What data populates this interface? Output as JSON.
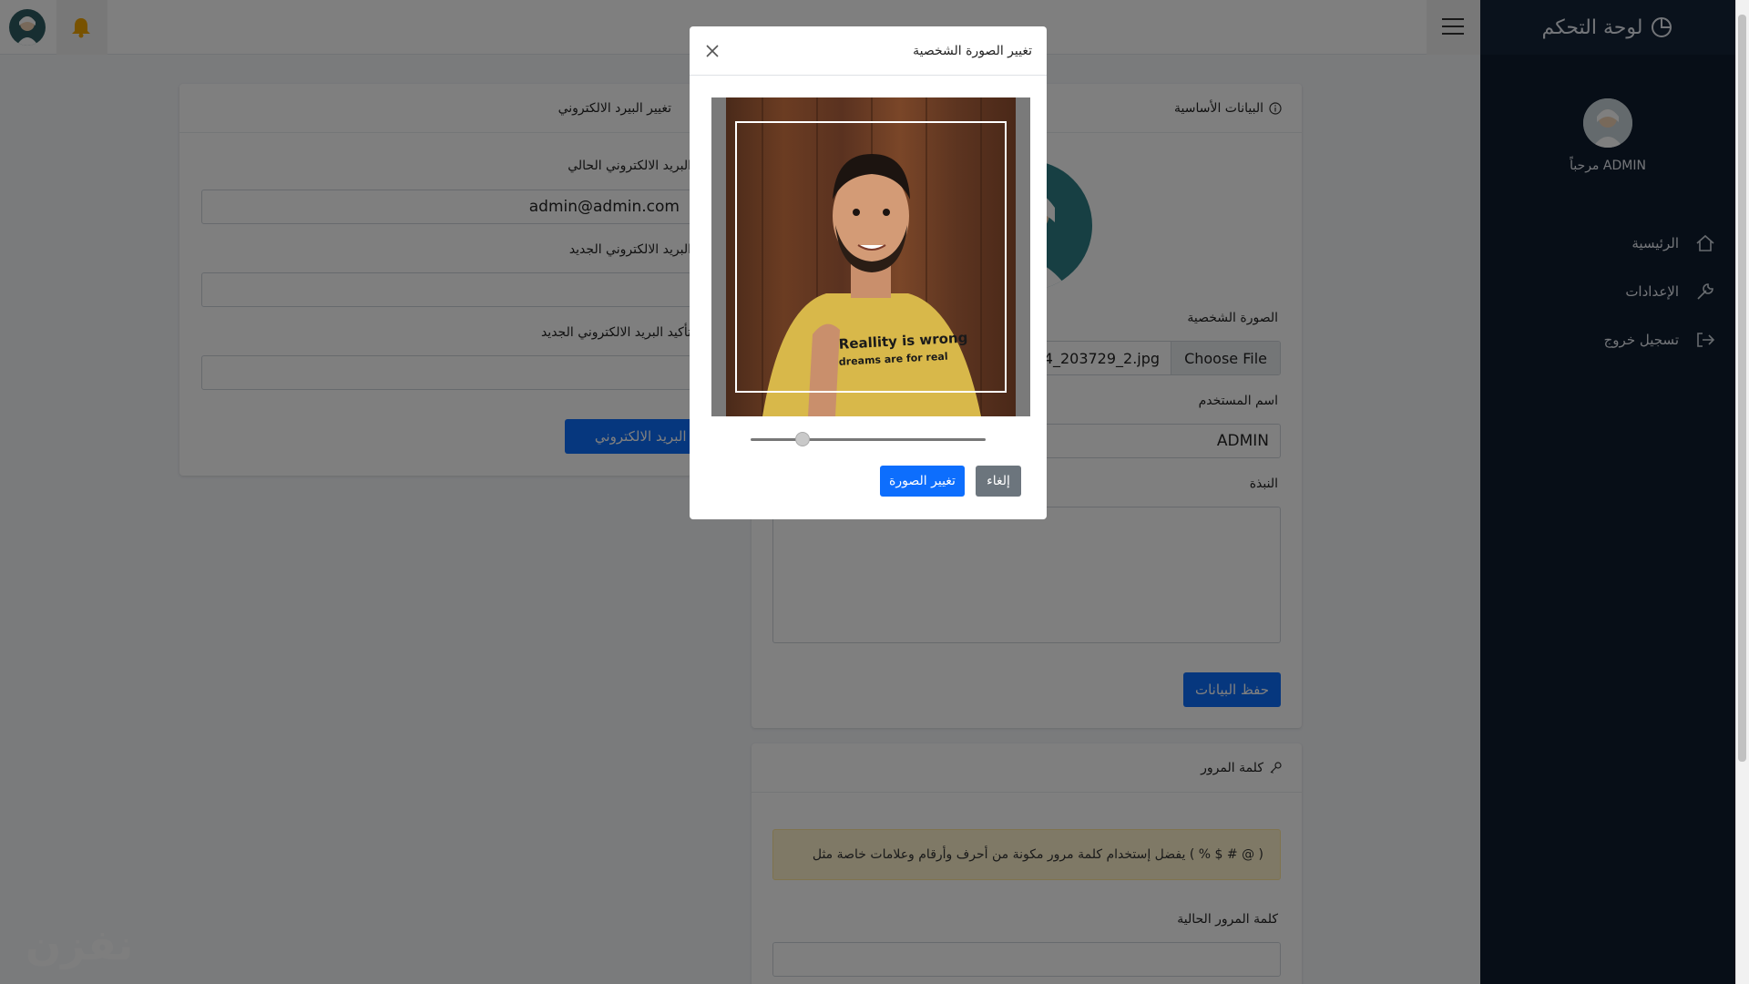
{
  "sidebar": {
    "title": "لوحة التحكم",
    "welcome": "مرحباً ADMIN",
    "items": [
      {
        "label": "الرئيسية",
        "icon": "home-icon"
      },
      {
        "label": "الإعدادات",
        "icon": "wrench-icon"
      },
      {
        "label": "تسجيل خروج",
        "icon": "logout-icon"
      }
    ]
  },
  "basic_card": {
    "title": "البيانات الأساسية",
    "photo_label": "الصورة الشخصية",
    "file_button": "Choose File",
    "file_name": "104_203729_2.jpg",
    "username_label": "اسم المستخدم",
    "username_value": "ADMIN",
    "bio_label": "النبذة",
    "save_button": "حفظ البيانات"
  },
  "email_card": {
    "title": "تغيير البيرد الالكتروني",
    "current_label": "البريد الالكتروني الحالي",
    "current_value": "admin@admin.com",
    "new_label": "البريد الالكتروني الجديد",
    "confirm_label": "تأكيد البريد الالكتروني الجديد",
    "submit_button": "تغيير البريد الالكتروني"
  },
  "password_card": {
    "title": "كلمة المرور",
    "hint": "يفضل إستخدام كلمة مرور مكونة من أحرف وأرقام وعلامات خاصة مثل ( % $ # @ )",
    "current_label": "كلمة المرور الحالية"
  },
  "modal": {
    "title": "تغيير الصورة الشخصية",
    "shirt_text_1": "Reallity is wrong",
    "shirt_text_2": "dreams are for real",
    "zoom_level": 0.22,
    "cancel_button": "إلغاء",
    "confirm_button": "تغيير الصورة"
  },
  "watermark": "نفزن",
  "colors": {
    "primary": "#0d6efd",
    "sidebar": "#0f1c2e",
    "bell": "#f0a500"
  }
}
